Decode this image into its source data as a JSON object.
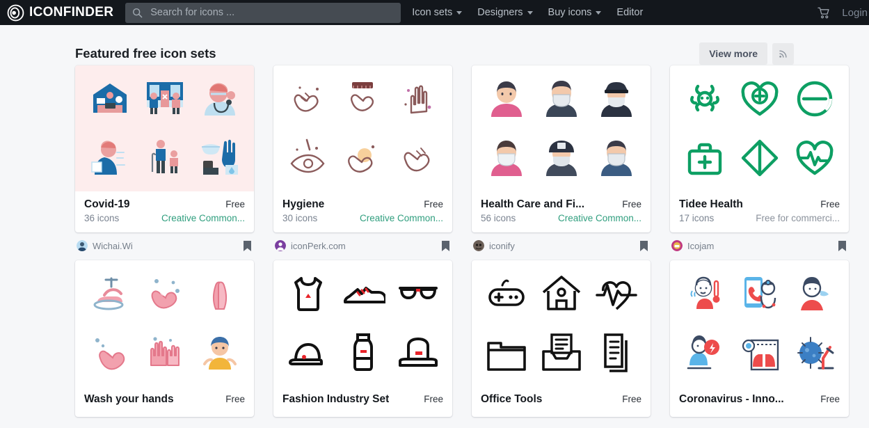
{
  "brand": {
    "name": "ICONFINDER",
    "logo_icon": "iconfinder-logo-icon"
  },
  "search": {
    "placeholder": "Search for icons ...",
    "value": "",
    "icon": "search-icon"
  },
  "nav": {
    "items": [
      {
        "label": "Icon sets",
        "has_dropdown": true
      },
      {
        "label": "Designers",
        "has_dropdown": true
      },
      {
        "label": "Buy icons",
        "has_dropdown": true
      },
      {
        "label": "Editor",
        "has_dropdown": false
      }
    ],
    "cart_icon": "shopping-cart-icon",
    "login_label": "Login"
  },
  "section": {
    "title": "Featured free icon sets",
    "view_more_label": "View more",
    "rss_icon": "rss-icon"
  },
  "colors": {
    "nav_bg": "#13171c",
    "page_bg": "#f6f7f9",
    "license_green": "#2f9e7e",
    "card_tint_pink": "#fdeded",
    "button_bg": "#e9eaec"
  },
  "sets": [
    {
      "name": "Covid-19",
      "price": "Free",
      "count": "36 icons",
      "license": "Creative Common...",
      "license_muted": false,
      "author": "Wichai.Wi",
      "avatar_color": "#9ec9e8",
      "tint": "pink",
      "style": "flat-pink-blue",
      "bookmark_icon": "bookmark-icon"
    },
    {
      "name": "Hygiene",
      "price": "Free",
      "count": "30 icons",
      "license": "Creative Common...",
      "license_muted": false,
      "author": "iconPerk.com",
      "avatar_color": "#7b3fa0",
      "tint": "none",
      "style": "line-hands",
      "bookmark_icon": "bookmark-icon"
    },
    {
      "name": "Health Care and Fi...",
      "price": "Free",
      "count": "56 icons",
      "license": "Creative Common...",
      "license_muted": false,
      "author": "iconify",
      "avatar_color": "#6b5f57",
      "tint": "none",
      "style": "avatars",
      "bookmark_icon": "bookmark-icon"
    },
    {
      "name": "Tidee Health",
      "price": "Free",
      "count": "17 icons",
      "license": "Free for commerci...",
      "license_muted": true,
      "author": "Icojam",
      "avatar_color": "#c0397f",
      "tint": "none",
      "style": "green-line",
      "bookmark_icon": "bookmark-icon"
    },
    {
      "name": "Wash your hands",
      "price": "Free",
      "count": "",
      "license": "",
      "license_muted": false,
      "author": "",
      "avatar_color": "#9ec9e8",
      "tint": "none",
      "style": "pink-hands",
      "bookmark_icon": "bookmark-icon"
    },
    {
      "name": "Fashion Industry Set",
      "price": "Free",
      "count": "",
      "license": "",
      "license_muted": false,
      "author": "",
      "avatar_color": "#9ec9e8",
      "tint": "none",
      "style": "black-fashion",
      "bookmark_icon": "bookmark-icon"
    },
    {
      "name": "Office Tools",
      "price": "Free",
      "count": "",
      "license": "",
      "license_muted": false,
      "author": "",
      "avatar_color": "#9ec9e8",
      "tint": "none",
      "style": "black-office",
      "bookmark_icon": "bookmark-icon"
    },
    {
      "name": "Coronavirus - Inno...",
      "price": "Free",
      "count": "",
      "license": "",
      "license_muted": false,
      "author": "",
      "avatar_color": "#9ec9e8",
      "tint": "none",
      "style": "corona-color",
      "bookmark_icon": "bookmark-icon"
    }
  ]
}
